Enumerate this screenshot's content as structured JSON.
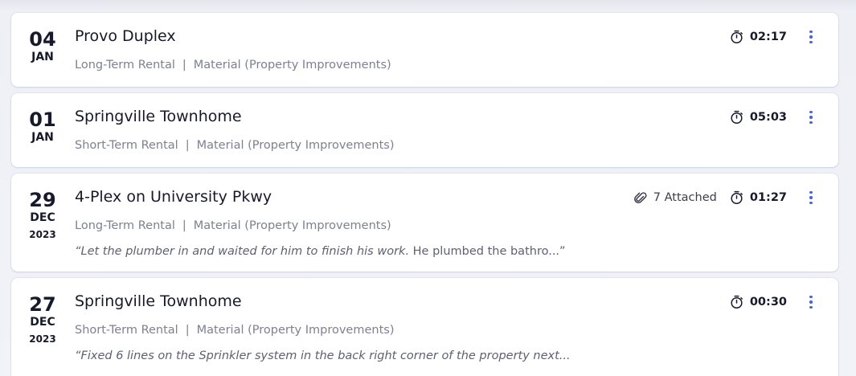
{
  "entries": [
    {
      "day": "04",
      "month": "JAN",
      "year": "",
      "title": "Provo Duplex",
      "rental_type": "Long-Term Rental",
      "separator": "|",
      "category": "Material (Property Improvements)",
      "attachments": "",
      "duration": "02:17",
      "note_italic": "",
      "note_plain": ""
    },
    {
      "day": "01",
      "month": "JAN",
      "year": "",
      "title": "Springville Townhome",
      "rental_type": "Short-Term Rental",
      "separator": "|",
      "category": "Material (Property Improvements)",
      "attachments": "",
      "duration": "05:03",
      "note_italic": "",
      "note_plain": ""
    },
    {
      "day": "29",
      "month": "DEC",
      "year": "2023",
      "title": "4-Plex on University Pkwy",
      "rental_type": "Long-Term Rental",
      "separator": "|",
      "category": "Material (Property Improvements)",
      "attachments": "7 Attached",
      "duration": "01:27",
      "note_italic": "“Let the plumber in and waited for him to finish his work.",
      "note_plain": " He plumbed the bathro...”"
    },
    {
      "day": "27",
      "month": "DEC",
      "year": "2023",
      "title": "Springville Townhome",
      "rental_type": "Short-Term Rental",
      "separator": "|",
      "category": "Material (Property Improvements)",
      "attachments": "",
      "duration": "00:30",
      "note_italic": "“Fixed 6 lines on the Sprinkler system in the back right corner of the property next...",
      "note_plain": ""
    }
  ],
  "icons": {
    "timer": "stopwatch-icon",
    "attach": "paperclip-icon",
    "menu": "more-vertical-icon"
  },
  "colors": {
    "accent": "#4a63d6",
    "text_primary": "#161a2a",
    "text_muted": "#7d8190",
    "background": "#eef0f6",
    "card": "#ffffff"
  }
}
